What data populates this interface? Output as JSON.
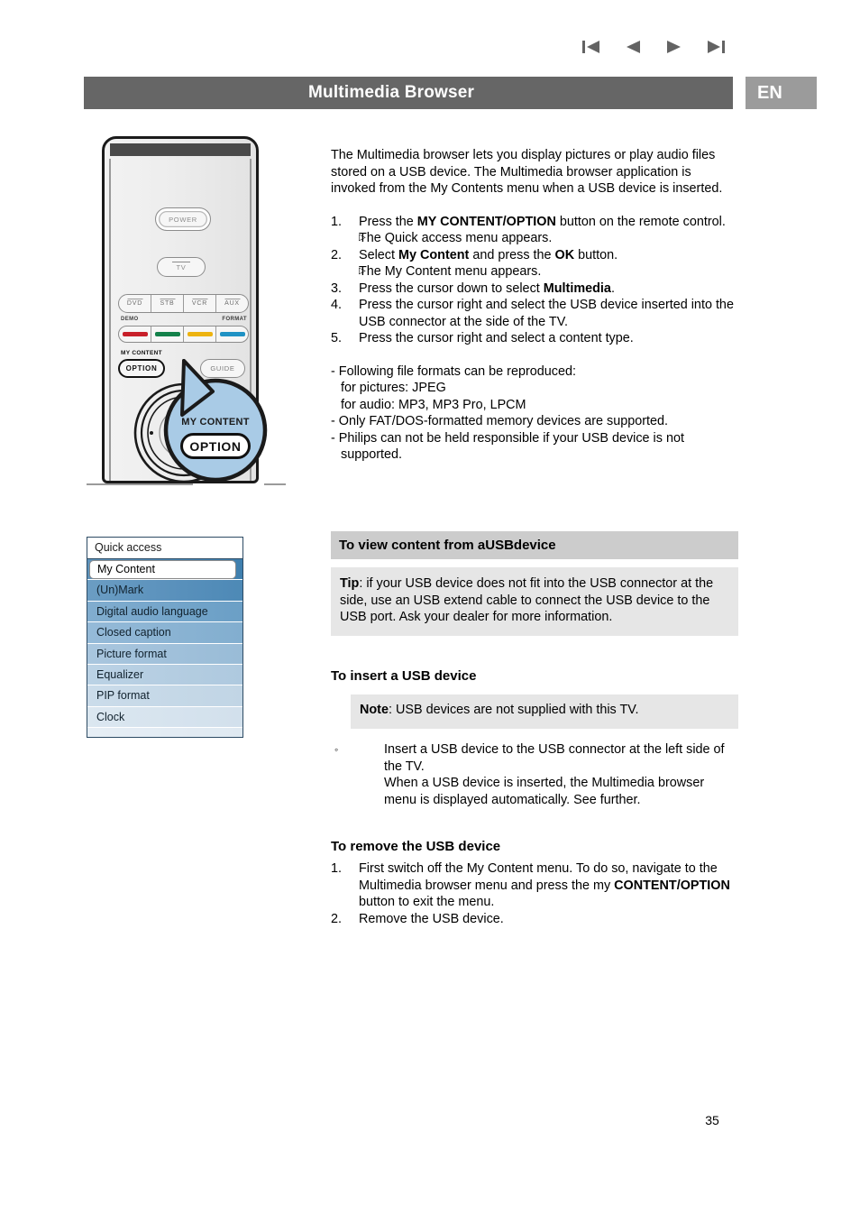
{
  "header": {
    "title": "Multimedia Browser",
    "language_badge": "EN",
    "nav_icons": [
      "first-page-icon",
      "previous-page-icon",
      "next-page-icon",
      "last-page-icon"
    ],
    "bar_color": "#666666",
    "badge_color": "#9b9b9b"
  },
  "remote": {
    "power_label": "POWER",
    "tv_label": "TV",
    "source_buttons": [
      "DVD",
      "STB",
      "VCR",
      "AUX"
    ],
    "demo_label": "DEMO",
    "format_label": "FORMAT",
    "color_keys": [
      "#c8202a",
      "#13814a",
      "#edb310",
      "#1f92c4"
    ],
    "my_content_label": "MY CONTENT",
    "option_label": "OPTION",
    "guide_label": "GUIDE",
    "callout": {
      "title": "MY CONTENT",
      "button": "OPTION",
      "bubble_color": "#a9cbe6"
    }
  },
  "osd": {
    "header": "Quick access",
    "selected": "My Content",
    "items": [
      "My Content",
      "(Un)Mark",
      "Digital audio language",
      "Closed caption",
      "Picture format",
      "Equalizer",
      "PIP format",
      "Clock"
    ]
  },
  "main": {
    "intro": "The Multimedia browser lets you display pictures or play audio files stored on a USB device. The Multimedia browser application is invoked from the My Contents menu when a USB device is inserted.",
    "steps": [
      {
        "num": "1.",
        "text_pre": "Press the ",
        "bold": "MY CONTENT/OPTION",
        "text_post": " button on the remote control.",
        "sub": "The Quick access menu appears."
      },
      {
        "num": "2.",
        "text_pre": "Select ",
        "bold": "My Content",
        "text_mid": " and press the ",
        "bold2": "OK",
        "text_post": " button.",
        "sub": "The My Content menu appears."
      },
      {
        "num": "3.",
        "text_pre": "Press the cursor down to select ",
        "bold": "Multimedia",
        "text_post": "."
      },
      {
        "num": "4.",
        "text_pre": "Press the cursor right and select the USB device inserted into the USB connector at the side of the TV."
      },
      {
        "num": "5.",
        "text_pre": "Press the cursor right and select a content type."
      }
    ],
    "notes": [
      "- Following file formats can be reproduced:",
      "for pictures: JPEG",
      "for audio: MP3, MP3 Pro, LPCM",
      "- Only FAT/DOS-formatted memory devices are supported.",
      "- Philips can not be held responsible if your USB device is not supported."
    ],
    "view_section": {
      "heading_pre": "To view content from a ",
      "heading_bold": "USB",
      "heading_post": " device",
      "tip_label": "Tip",
      "tip_text": ": if your USB device does not fit into the USB connector at the side, use an USB extend cable to connect the USB device to the USB port. Ask your dealer for more information."
    },
    "insert_section": {
      "heading_pre": "To insert a ",
      "heading_bold": "USB",
      "heading_post": " device",
      "note_label": "Note",
      "note_text": ": USB devices are not supplied with this TV.",
      "bullet": "Insert a USB device to the USB connector at the left side of the TV.",
      "bullet_cont1": "When a USB device is inserted, the Multimedia browser",
      "bullet_cont2": "menu is displayed automatically. See further."
    },
    "remove_section": {
      "heading_pre": "To remove the ",
      "heading_bold": "USB",
      "heading_post": " device",
      "step1_pre": "First switch off the My Content menu. To do so, navigate to the Multimedia browser menu and press the my ",
      "step1_bold": "CONTENT/OPTION",
      "step1_post": " button to exit the menu.",
      "step1_num": "1.",
      "step2_num": "2.",
      "step2_text": "Remove the USB device."
    }
  },
  "footer": {
    "page_number": "35"
  }
}
